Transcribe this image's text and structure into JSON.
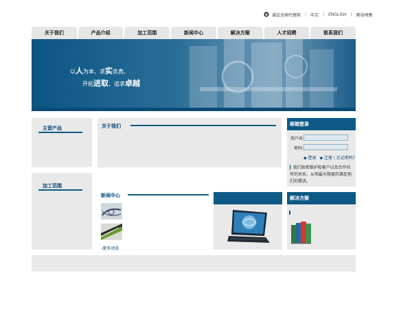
{
  "topbar": {
    "cert_text": "诚证全国代理商",
    "chinese": "中文",
    "english": "ENGLISH",
    "sitemap": "网站地图"
  },
  "nav": {
    "items": [
      "关于我们",
      "产品介绍",
      "加工范围",
      "新闻中心",
      "解决方案",
      "人才招聘",
      "联系我们"
    ]
  },
  "banner": {
    "line1_a": "以",
    "line1_b": "人",
    "line1_c": "为本、求",
    "line1_d": "实",
    "line1_e": "务真、",
    "line2_a": "开拓",
    "line2_b": "进取",
    "line2_c": "、追求",
    "line2_d": "卓越"
  },
  "sidebar": {
    "products_title": "主营产品",
    "range_title": "加工范围"
  },
  "about": {
    "title": "关于我们"
  },
  "login": {
    "title": "邮箱登录",
    "username_label": "用户名:",
    "password_label": "密码:",
    "login_link": "◆ 登录",
    "register_link": "◆ 注册",
    "forgot_link": "忘记密码?",
    "note": "我们致密维护和客户以及合作伙伴的关系，从用最大限度的满足他们的需求。"
  },
  "news": {
    "title": "新闻中心",
    "more": "更多动态"
  },
  "solutions": {
    "title": "解决方案"
  },
  "colors": {
    "brand_blue": "#0d5a86",
    "panel_gray": "#e9e9e9"
  }
}
